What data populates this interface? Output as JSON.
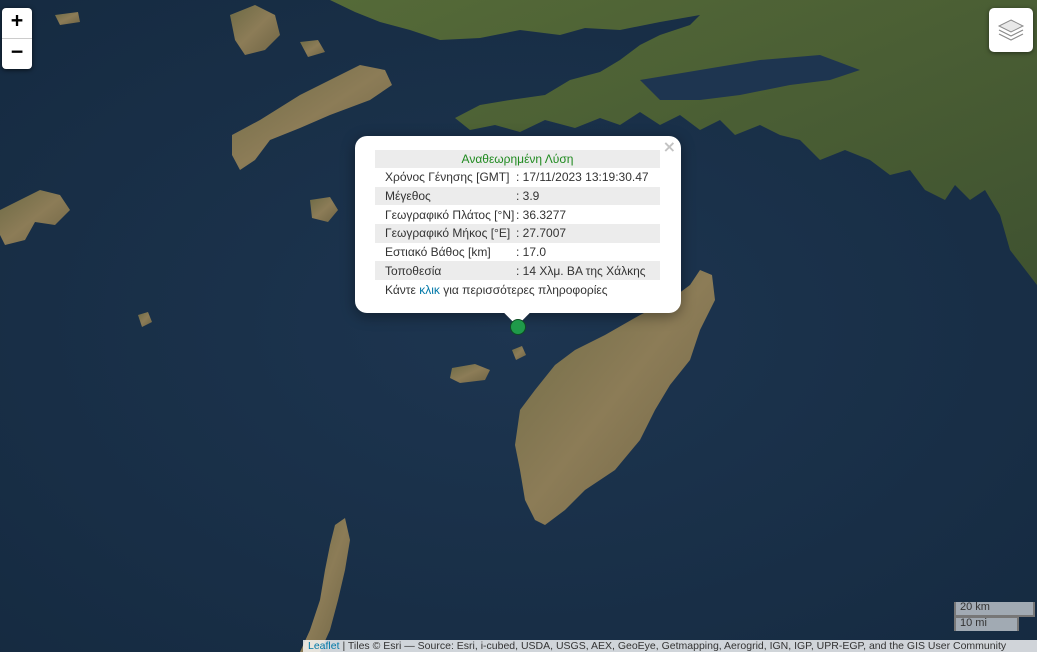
{
  "map": {
    "basemap": "satellite imagery",
    "colors": {
      "sea": "#1c3249",
      "land": "#8b7b55",
      "vegetation": "#4a5a32"
    }
  },
  "controls": {
    "zoom_in": "+",
    "zoom_out": "−",
    "layers_icon": "layers-icon"
  },
  "popup": {
    "close": "×",
    "title": "Αναθεωρημένη Λύση",
    "rows": [
      {
        "label": "Χρόνος Γένησης [GMT]",
        "value": ": 17/11/2023 13:19:30.47"
      },
      {
        "label": "Μέγεθος",
        "value": ": 3.9"
      },
      {
        "label": "Γεωγραφικό Πλάτος [°N]",
        "value": ": 36.3277"
      },
      {
        "label": "Γεωγραφικό Μήκος [°E]",
        "value": ": 27.7007"
      },
      {
        "label": "Εστιακό Βάθος [km]",
        "value": ": 17.0"
      },
      {
        "label": "Τοποθεσία",
        "value": ": 14 Χλμ. ΒΑ της Χάλκης"
      }
    ],
    "more_prefix": "Κάντε ",
    "more_link": "κλικ",
    "more_suffix": " για περισσότερες πληροφορίες"
  },
  "marker": {
    "color": "#1f9a4a"
  },
  "scale": {
    "km": "20 km",
    "mi": "10 mi"
  },
  "attribution": {
    "link": "Leaflet",
    "text": " | Tiles © Esri — Source: Esri, i-cubed, USDA, USGS, AEX, GeoEye, Getmapping, Aerogrid, IGN, IGP, UPR-EGP, and the GIS User Community"
  }
}
